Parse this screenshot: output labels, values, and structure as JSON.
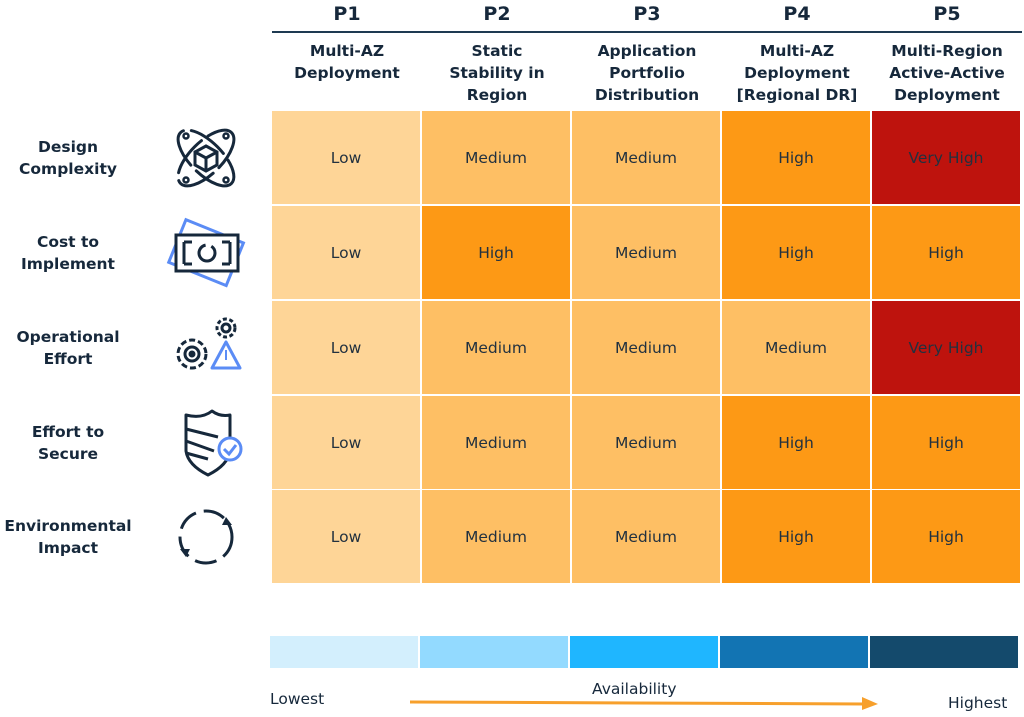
{
  "columns": [
    {
      "code": "P1",
      "title_lines": [
        "Multi-AZ",
        "Deployment"
      ]
    },
    {
      "code": "P2",
      "title_lines": [
        "Static",
        "Stability in",
        "Region"
      ]
    },
    {
      "code": "P3",
      "title_lines": [
        "Application",
        "Portfolio",
        "Distribution"
      ]
    },
    {
      "code": "P4",
      "title_lines": [
        "Multi-AZ",
        "Deployment",
        "[Regional DR]"
      ]
    },
    {
      "code": "P5",
      "title_lines": [
        "Multi-Region",
        "Active-Active",
        "Deployment"
      ]
    }
  ],
  "rows": [
    {
      "label_lines": [
        "Design",
        "Complexity"
      ],
      "icon": "atom-cube-icon",
      "values": [
        "Low",
        "Medium",
        "Medium",
        "High",
        "Very High"
      ]
    },
    {
      "label_lines": [
        "Cost to",
        "Implement"
      ],
      "icon": "banknote-icon",
      "values": [
        "Low",
        "High",
        "Medium",
        "High",
        "High"
      ]
    },
    {
      "label_lines": [
        "Operational",
        "Effort"
      ],
      "icon": "gears-warning-icon",
      "values": [
        "Low",
        "Medium",
        "Medium",
        "Medium",
        "Very High"
      ]
    },
    {
      "label_lines": [
        "Effort to",
        "Secure"
      ],
      "icon": "shield-check-icon",
      "values": [
        "Low",
        "Medium",
        "Medium",
        "High",
        "High"
      ]
    },
    {
      "label_lines": [
        "Environmental",
        "Impact"
      ],
      "icon": "recycle-arrows-icon",
      "values": [
        "Low",
        "Medium",
        "Medium",
        "High",
        "High"
      ]
    }
  ],
  "level_colors": {
    "Low": "#fed597",
    "Medium": "#febf64",
    "High": "#fd9915",
    "Very High": "#be130d"
  },
  "legend": {
    "title": "Availability",
    "low_label": "Lowest",
    "high_label": "Highest",
    "scale_colors": [
      "#d3effd",
      "#93daff",
      "#1fb6ff",
      "#1274b3",
      "#144a6c"
    ],
    "arrow_color": "#f7a02c"
  }
}
